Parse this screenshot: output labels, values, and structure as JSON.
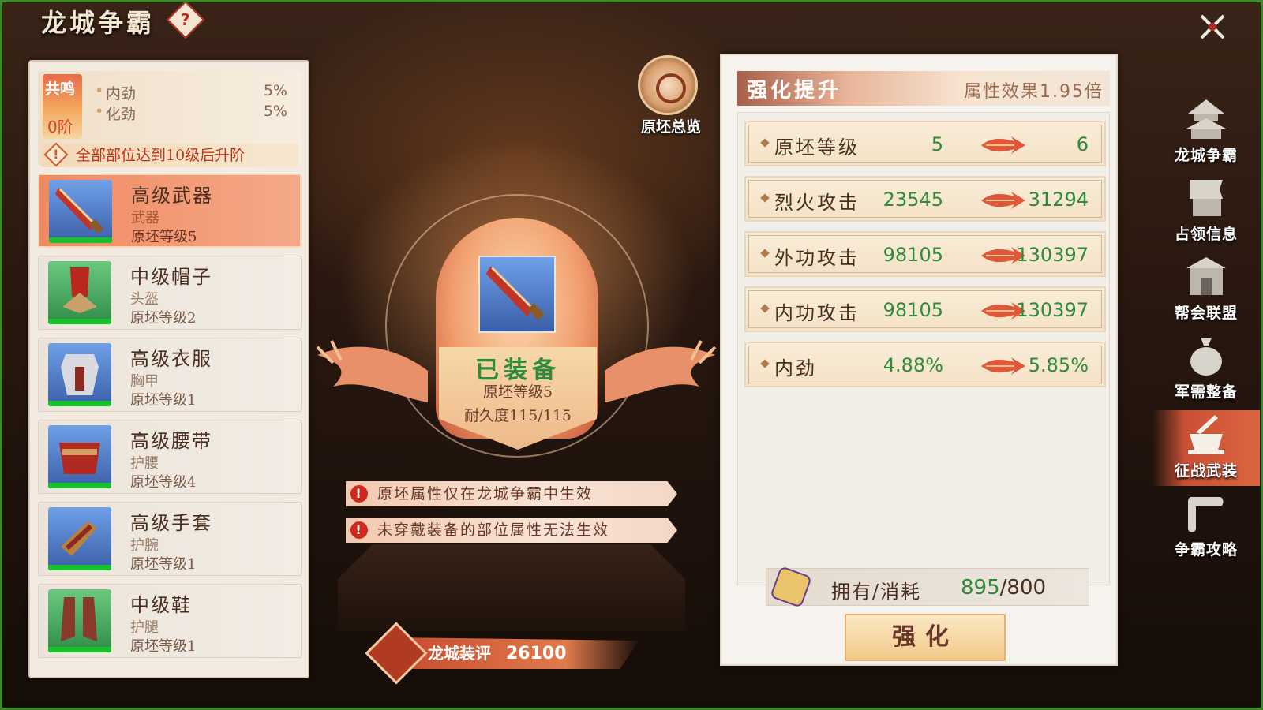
{
  "header": {
    "title": "龙城争霸"
  },
  "resonance": {
    "badge_label": "共鸣",
    "stage": "0阶",
    "stats": [
      {
        "name": "内劲",
        "value": "5%"
      },
      {
        "name": "化劲",
        "value": "5%"
      }
    ],
    "note": "全部部位达到10级后升阶"
  },
  "equipment_list": [
    {
      "name": "高级武器",
      "type": "武器",
      "level": "原坯等级5",
      "selected": true,
      "rarity": "blue"
    },
    {
      "name": "中级帽子",
      "type": "头盔",
      "level": "原坯等级2",
      "selected": false,
      "rarity": "green"
    },
    {
      "name": "高级衣服",
      "type": "胸甲",
      "level": "原坯等级1",
      "selected": false,
      "rarity": "blue"
    },
    {
      "name": "高级腰带",
      "type": "护腰",
      "level": "原坯等级4",
      "selected": false,
      "rarity": "blue"
    },
    {
      "name": "高级手套",
      "type": "护腕",
      "level": "原坯等级1",
      "selected": false,
      "rarity": "blue"
    },
    {
      "name": "中级鞋",
      "type": "护腿",
      "level": "原坯等级1",
      "selected": false,
      "rarity": "green"
    }
  ],
  "center": {
    "overview_label": "原坯总览",
    "status": "已装备",
    "level": "原坯等级5",
    "durability": "耐久度115/115",
    "notices": [
      "原坯属性仅在龙城争霸中生效",
      "未穿戴装备的部位属性无法生效"
    ],
    "rating_label": "龙城装评",
    "rating_value": "26100"
  },
  "enhance_panel": {
    "title": "强化提升",
    "effect_label": "属性效果",
    "effect_value": "1.95倍",
    "stats": [
      {
        "name": "原坯等级",
        "from": "5",
        "to": "6"
      },
      {
        "name": "烈火攻击",
        "from": "23545",
        "to": "31294"
      },
      {
        "name": "外功攻击",
        "from": "98105",
        "to": "130397"
      },
      {
        "name": "内功攻击",
        "from": "98105",
        "to": "130397"
      },
      {
        "name": "内劲",
        "from": "4.88%",
        "to": "5.85%"
      }
    ],
    "own_label": "拥有/消耗",
    "own_value": "895",
    "cost_value": "/800",
    "button_label": "强化"
  },
  "side_nav": [
    {
      "label": "龙城争霸",
      "icon": "tower-icon",
      "active": false
    },
    {
      "label": "占领信息",
      "icon": "banner-icon",
      "active": false
    },
    {
      "label": "帮会联盟",
      "icon": "gate-icon",
      "active": false
    },
    {
      "label": "军需整备",
      "icon": "bag-icon",
      "active": false
    },
    {
      "label": "征战武装",
      "icon": "armory-icon",
      "active": true
    },
    {
      "label": "争霸攻略",
      "icon": "scroll-icon",
      "active": false
    }
  ],
  "colors": {
    "accent_green": "#2f8a3c",
    "selected_orange": "#f08a60",
    "warning_red": "#d0281c"
  }
}
